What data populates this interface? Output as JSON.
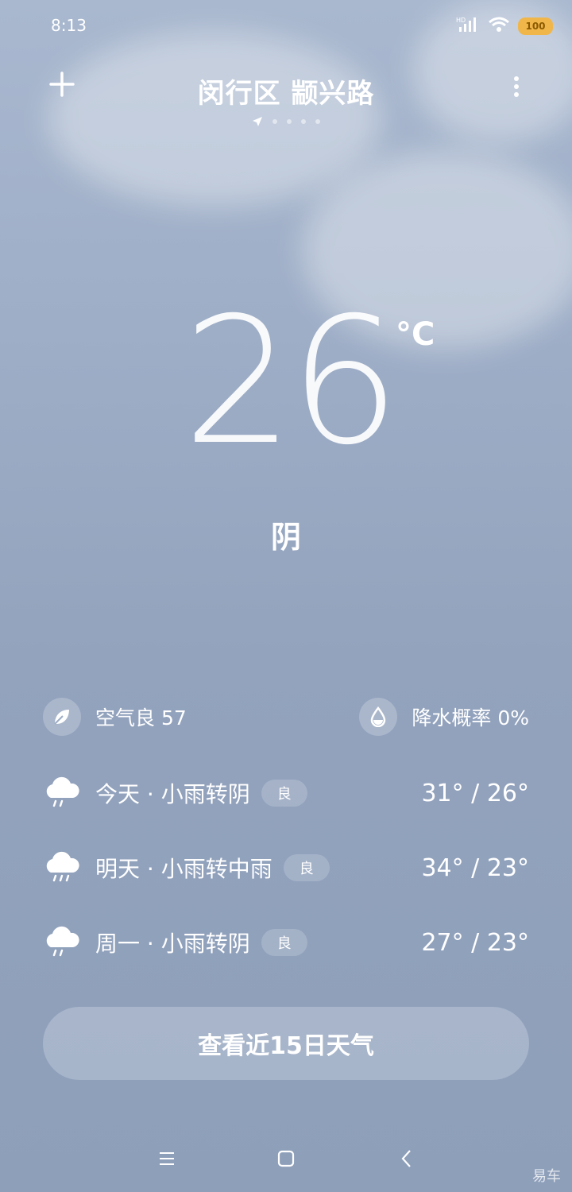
{
  "status": {
    "time": "8:13",
    "network_label": "HD",
    "battery": "100"
  },
  "header": {
    "location": "闵行区 颛兴路"
  },
  "current": {
    "temperature": "26",
    "unit": "°C",
    "condition": "阴"
  },
  "metrics": {
    "air": {
      "label": "空气良 57",
      "icon": "leaf-icon"
    },
    "rain": {
      "label": "降水概率 0%",
      "icon": "droplet-icon"
    }
  },
  "forecast": [
    {
      "day": "今天 · 小雨转阴",
      "aqi": "良",
      "range": "31° / 26°",
      "icon": "cloud-rain-icon"
    },
    {
      "day": "明天 · 小雨转中雨",
      "aqi": "良",
      "range": "34° / 23°",
      "icon": "cloud-rain-icon"
    },
    {
      "day": "周一 · 小雨转阴",
      "aqi": "良",
      "range": "27° / 23°",
      "icon": "cloud-rain-icon"
    }
  ],
  "button_15": "查看近15日天气",
  "watermark": "易车",
  "colors": {
    "battery": "#f1b64a",
    "bg_top": "#a9b8cf",
    "bg_bottom": "#8e9fba"
  }
}
